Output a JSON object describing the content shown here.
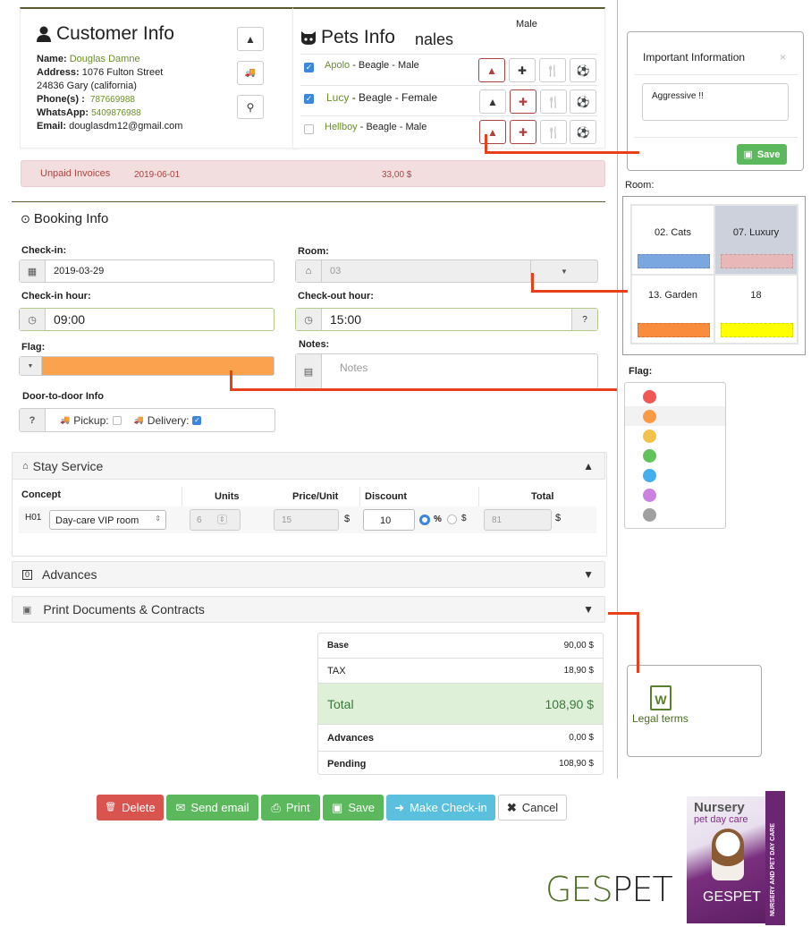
{
  "customer": {
    "title": "Customer Info",
    "name_label": "Name:",
    "name": "Douglas Damne",
    "address_label": "Address:",
    "address_line1": "1076 Fulton Street",
    "address_line2": "24836  Gary (california)",
    "phone_label": "Phone(s) :",
    "phone": "787669988",
    "whatsapp_label": "WhatsApp:",
    "whatsapp": "5409876988",
    "email_label": "Email:",
    "email": "douglasdm12@gmail.com"
  },
  "pets": {
    "title": "Pets Info",
    "overlay_text": "nales",
    "overlay_male": "Male",
    "items": [
      {
        "name": "Apolo",
        "details": " - Beagle - Male",
        "checked": true
      },
      {
        "name": "Lucy",
        "details": " - Beagle - Female",
        "checked": true
      },
      {
        "name": "Hellboy",
        "details": " - Beagle -  Male",
        "checked": false
      }
    ]
  },
  "invoice": {
    "label": "Unpaid Invoices",
    "date": "2019-06-01",
    "amount": "33,00 $"
  },
  "booking": {
    "title": "Booking Info",
    "checkin_label": "Check-in:",
    "checkin_value": "2019-03-29",
    "room_label": "Room:",
    "room_value": "03",
    "checkin_hour_label": "Check-in hour:",
    "checkin_hour_value": "09:00",
    "checkout_hour_label": "Check-out hour:",
    "checkout_hour_value": "15:00",
    "flag_label": "Flag:",
    "flag_color": "#fba24f",
    "notes_label": "Notes:",
    "notes_placeholder": "Notes",
    "door_label": "Door-to-door Info",
    "door_addon": "?",
    "pickup_label": "Pickup:",
    "delivery_label": "Delivery:"
  },
  "stay": {
    "title": "Stay Service",
    "headers": {
      "concept": "Concept",
      "units": "Units",
      "price": "Price/Unit",
      "discount": "Discount",
      "total": "Total"
    },
    "row": {
      "code": "H01",
      "concept": "Day-care VIP room",
      "units": "6",
      "price": "15",
      "currency": "$",
      "discount": "10",
      "pct": "%",
      "dollar": "$",
      "total": "81"
    }
  },
  "advances": {
    "title": "Advances"
  },
  "print_docs": {
    "title": "Print Documents & Contracts"
  },
  "summary": {
    "base_label": "Base",
    "base": "90,00 $",
    "tax_label": "TAX",
    "tax": "18,90 $",
    "total_label": "Total",
    "total": "108,90 $",
    "advances_label": "Advances",
    "advances": "0,00 $",
    "pending_label": "Pending",
    "pending": "108,90 $"
  },
  "buttons": {
    "delete": "Delete",
    "send_email": "Send email",
    "print": "Print",
    "save": "Save",
    "checkin": "Make Check-in",
    "cancel": "Cancel"
  },
  "important_modal": {
    "title": "Important Information",
    "close": "×",
    "text": "Aggressive !!",
    "save": "Save"
  },
  "room_picker": {
    "label": "Room:",
    "rooms": [
      {
        "name": "02. Cats",
        "color": "#7ba7e0"
      },
      {
        "name": "07. Luxury",
        "color": "#e8b8b8"
      },
      {
        "name": "13. Garden",
        "color": "#f98c3d"
      },
      {
        "name": "18",
        "color": "#ffff00"
      }
    ]
  },
  "flag_picker": {
    "label": "Flag:",
    "colors": [
      "#f25757",
      "#fa9a45",
      "#f3c24c",
      "#63c25a",
      "#41aff0",
      "#cb82e0",
      "#a0a0a0"
    ]
  },
  "legal": {
    "label": "Legal terms",
    "icon_letter": "W"
  },
  "branding": {
    "logo_green": "GES",
    "logo_dark": "PET",
    "box_title": "Nursery",
    "box_subtitle": "pet day care",
    "box_side": "NURSERY AND PET DAY CARE",
    "box_brand": "GESPET"
  }
}
